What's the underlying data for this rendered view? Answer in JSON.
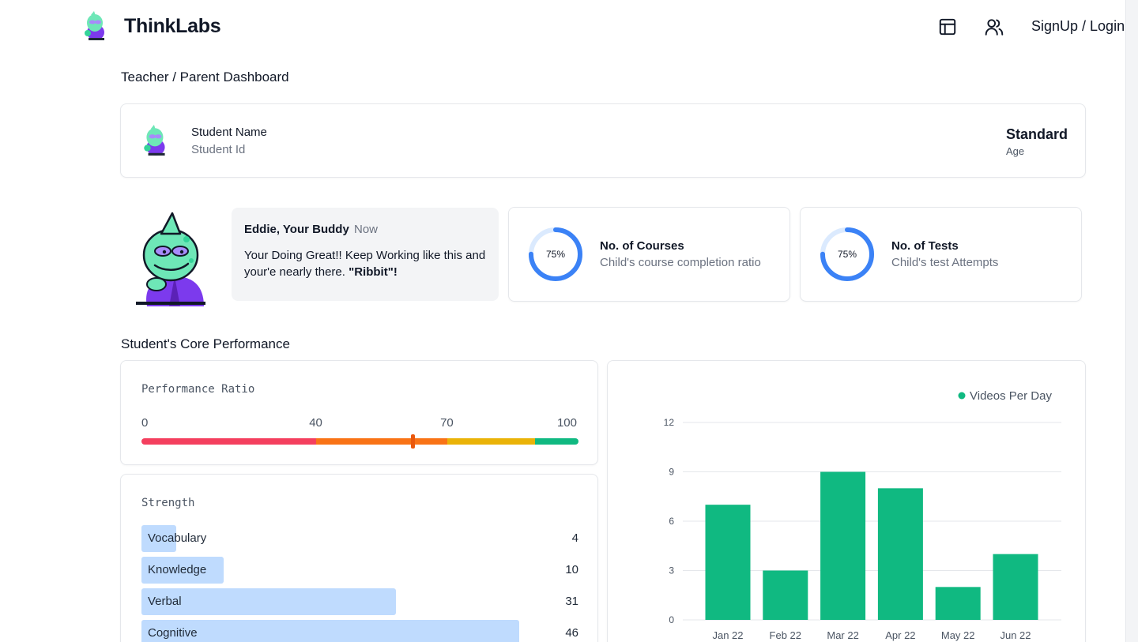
{
  "header": {
    "brand": "ThinkLabs",
    "login_label": "SignUp / Login",
    "icons": [
      "layout-icon",
      "users-icon"
    ]
  },
  "dashboard_title": "Teacher / Parent Dashboard",
  "student": {
    "name": "Student Name",
    "id_label": "Student Id",
    "standard": "Standard",
    "age_label": "Age"
  },
  "buddy": {
    "name": "Eddie, Your Buddy",
    "time": "Now",
    "message_main": "Your Doing Great!! Keep Working like this and your'e nearly there. ",
    "message_emph": "\"Ribbit\"!"
  },
  "stats": [
    {
      "percent_label": "75%",
      "percent": 75,
      "title": "No. of Courses",
      "subtitle": "Child's course completion ratio",
      "color": "#3b82f6"
    },
    {
      "percent_label": "75%",
      "percent": 75,
      "title": "No. of Tests",
      "subtitle": "Child's test Attempts",
      "color": "#3b82f6"
    }
  ],
  "core_title": "Student's Core Performance",
  "performance": {
    "title": "Performance Ratio",
    "ticks": [
      "0",
      "40",
      "70",
      "100"
    ],
    "marker_value": 62,
    "segments": [
      {
        "from": 0,
        "to": 40,
        "color": "#f43f5e"
      },
      {
        "from": 40,
        "to": 70,
        "color": "#f97316"
      },
      {
        "from": 70,
        "to": 90,
        "color": "#eab308"
      },
      {
        "from": 90,
        "to": 100,
        "color": "#10b981"
      }
    ]
  },
  "strength": {
    "title": "Strength",
    "max": 50,
    "items": [
      {
        "label": "Vocabulary",
        "value": 4
      },
      {
        "label": "Knowledge",
        "value": 10
      },
      {
        "label": "Verbal",
        "value": 31
      },
      {
        "label": "Cognitive",
        "value": 46
      }
    ]
  },
  "chart_data": {
    "type": "bar",
    "categories": [
      "Jan 22",
      "Feb 22",
      "Mar 22",
      "Apr 22",
      "May 22",
      "Jun 22"
    ],
    "series": [
      {
        "name": "Videos Per Day",
        "values": [
          7,
          3,
          9,
          8,
          2,
          4
        ],
        "color": "#10b981"
      }
    ],
    "yticks": [
      "0",
      "3",
      "6",
      "9",
      "12"
    ],
    "ylim": [
      0,
      12
    ],
    "grid": true,
    "legend": "top-right"
  }
}
